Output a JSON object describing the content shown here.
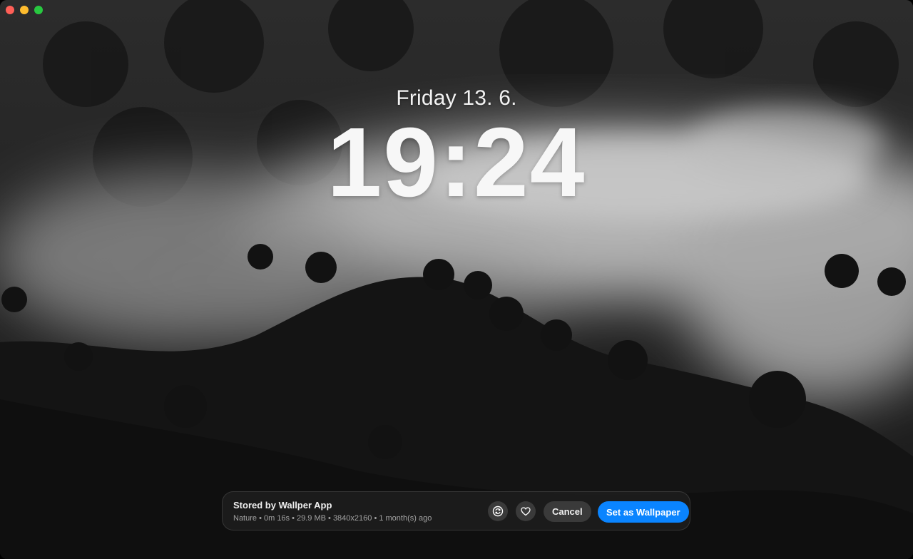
{
  "lock_screen": {
    "date": "Friday 13. 6.",
    "time": "19:24"
  },
  "info_bar": {
    "title": "Stored by Wallper App",
    "meta": "Nature • 0m 16s • 29.9 MB • 3840x2160 • 1 month(s) ago",
    "sync_icon": "sync-icon",
    "favorite_icon": "heart-icon",
    "cancel_label": "Cancel",
    "set_label": "Set as Wallpaper"
  },
  "colors": {
    "accent": "#0a84ff",
    "close": "#ff5f57",
    "minimize": "#febc2e",
    "maximize": "#28c840"
  }
}
